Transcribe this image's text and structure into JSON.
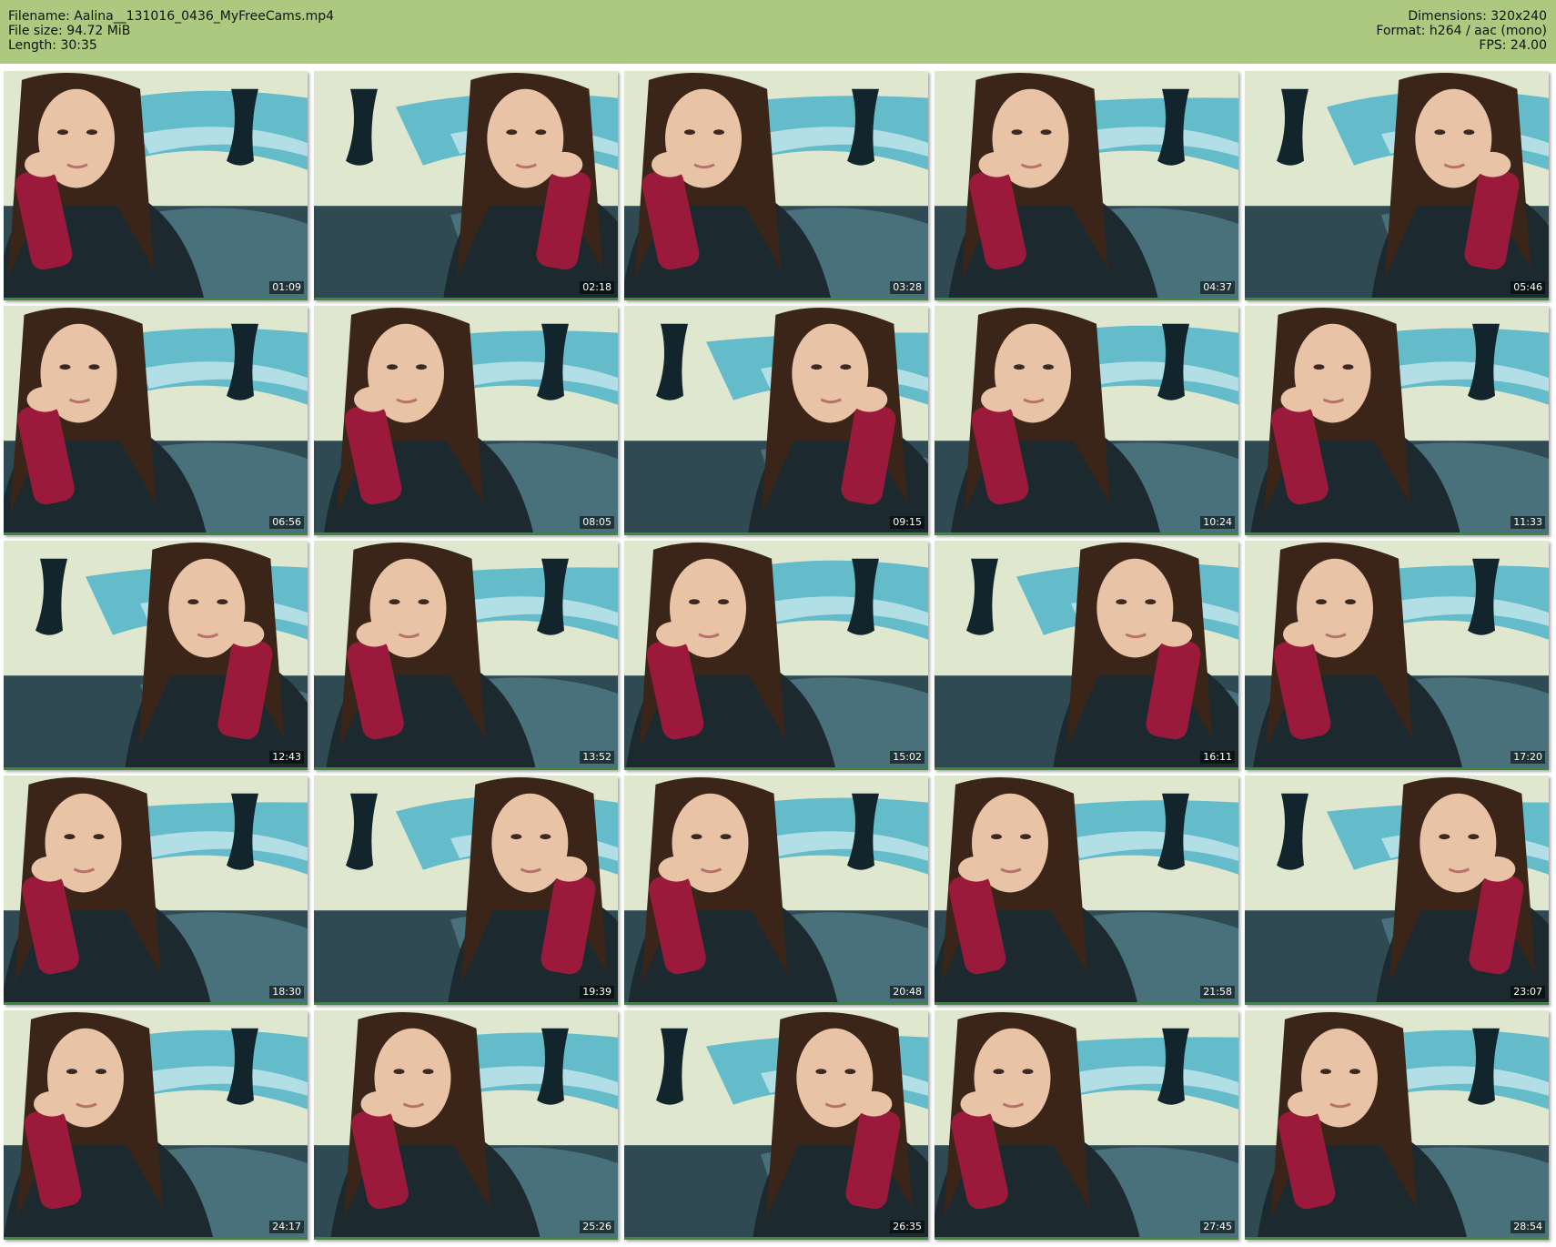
{
  "header": {
    "filename": "Filename: Aalina__131016_0436_MyFreeCams.mp4",
    "filesize": "File size: 94.72 MiB",
    "length": "Length: 30:35",
    "dimensions": "Dimensions: 320x240",
    "format": "Format: h264 / aac (mono)",
    "fps": "FPS: 24.00"
  },
  "thumbnails": [
    {
      "timestamp": "01:09"
    },
    {
      "timestamp": "02:18"
    },
    {
      "timestamp": "03:28"
    },
    {
      "timestamp": "04:37"
    },
    {
      "timestamp": "05:46"
    },
    {
      "timestamp": "06:56"
    },
    {
      "timestamp": "08:05"
    },
    {
      "timestamp": "09:15"
    },
    {
      "timestamp": "10:24"
    },
    {
      "timestamp": "11:33"
    },
    {
      "timestamp": "12:43"
    },
    {
      "timestamp": "13:52"
    },
    {
      "timestamp": "15:02"
    },
    {
      "timestamp": "16:11"
    },
    {
      "timestamp": "17:20"
    },
    {
      "timestamp": "18:30"
    },
    {
      "timestamp": "19:39"
    },
    {
      "timestamp": "20:48"
    },
    {
      "timestamp": "21:58"
    },
    {
      "timestamp": "23:07"
    },
    {
      "timestamp": "24:17"
    },
    {
      "timestamp": "25:26"
    },
    {
      "timestamp": "26:35"
    },
    {
      "timestamp": "27:45"
    },
    {
      "timestamp": "28:54"
    }
  ],
  "colors": {
    "header_bg": "#adc97f",
    "frame_border": "#3a8a3a",
    "wall": "#dfe8cf",
    "pattern": "#4fb4c9",
    "bedding": "#2f4a52",
    "top": "#1c2a30",
    "glove": "#9b1a3c",
    "hair": "#3b2519",
    "skin": "#e8c3a6"
  }
}
